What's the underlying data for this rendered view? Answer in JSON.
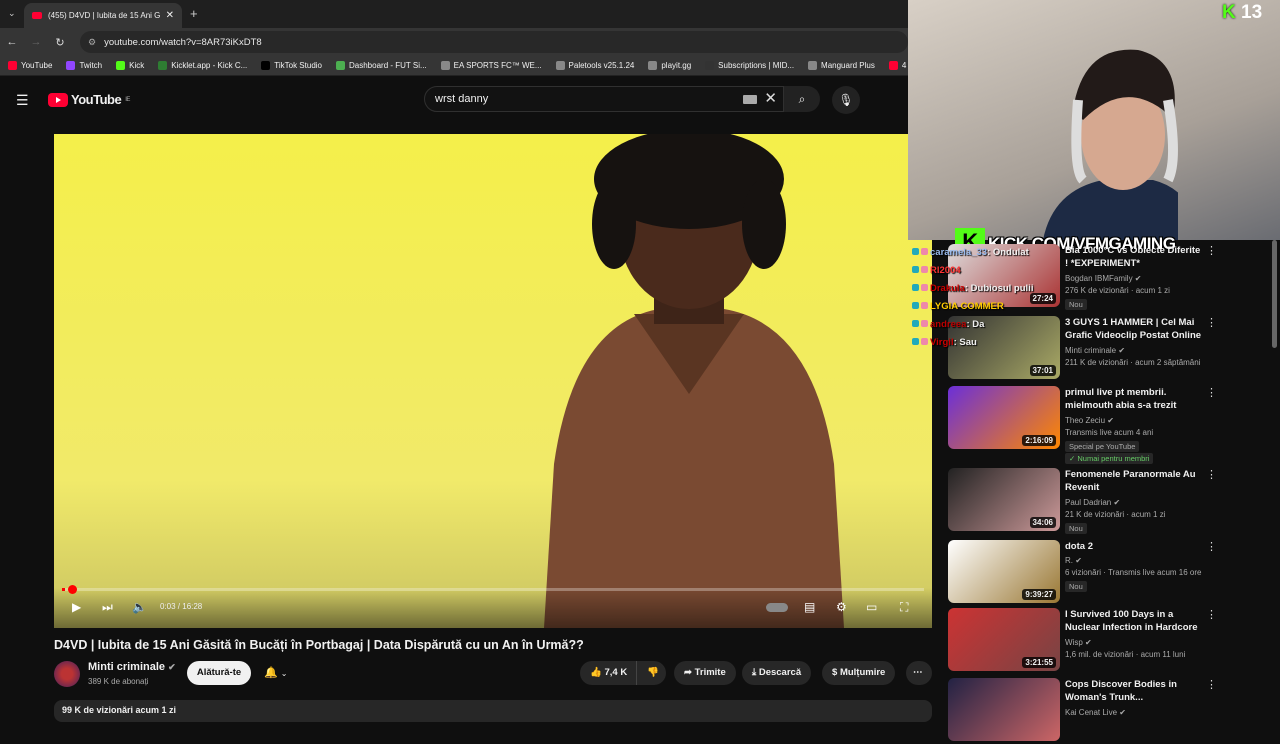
{
  "browser": {
    "tab_title": "(455) D4VD | Iubita de 15 Ani G...",
    "new_tab": "+",
    "url": "youtube.com/watch?v=8AR73iKxDT8",
    "bookmarks": [
      {
        "label": "YouTube",
        "color": "#ff0033"
      },
      {
        "label": "Twitch",
        "color": "#9146ff"
      },
      {
        "label": "Kick",
        "color": "#53fc18"
      },
      {
        "label": "Kicklet.app - Kick C...",
        "color": "#2e7d32"
      },
      {
        "label": "TikTok Studio",
        "color": "#000000"
      },
      {
        "label": "Dashboard - FUT Si...",
        "color": "#4caf50"
      },
      {
        "label": "EA SPORTS FC™ WE...",
        "color": "#888888"
      },
      {
        "label": "Paletools v25.1.24",
        "color": "#888888"
      },
      {
        "label": "playit.gg",
        "color": "#888888"
      },
      {
        "label": "Subscriptions | MID...",
        "color": "#333333"
      },
      {
        "label": "Manguard Plus",
        "color": "#888888"
      },
      {
        "label": "4 EASY Sto...",
        "color": "#ff0033"
      }
    ]
  },
  "youtube": {
    "logo_text": "YouTube",
    "logo_region": "IE",
    "search_value": "wrst danny"
  },
  "player": {
    "time": "0:03 / 16:28",
    "progress": 0.003
  },
  "video": {
    "title": "D4VD | Iubita de 15 Ani Găsită în Bucăți în Portbagaj | Data Dispărută cu un An în Urmă??",
    "channel": "Minti criminale",
    "subscribers": "389 K de abonați",
    "join_label": "Alătură-te",
    "likes": "7,4 K",
    "share_label": "Trimite",
    "download_label": "Descarcă",
    "thanks_label": "Mulțumire",
    "views_date": "99 K de vizionări  acum 1 zi"
  },
  "stream": {
    "viewer_count": "13",
    "kick_url": "KICK.COM/VFMGAMING",
    "kick_letter": "K",
    "chat": [
      {
        "user": "caramela_33",
        "message": "Ondulat"
      },
      {
        "user": "Rl2004",
        "message": ""
      },
      {
        "user": "Drakula",
        "message": "Dubiosul pulii"
      },
      {
        "user": "LYGIA COMMER",
        "message": ""
      },
      {
        "user": "andreea",
        "message": "Da"
      },
      {
        "user": "Virgil",
        "message": "Sau"
      }
    ]
  },
  "recommendations": [
    {
      "title": "Bia 1000°C vs Obiecte Diferite ! *EXPERIMENT*",
      "channel": "Bogdan IBMFamily",
      "meta": "276 K de vizionări · acum 1 zi",
      "duration": "27:24",
      "badge": "Nou",
      "extra": ""
    },
    {
      "title": "3 GUYS 1 HAMMER | Cel Mai Grafic Videoclip Postat Online ...",
      "channel": "Minti criminale",
      "meta": "211 K de vizionări · acum 2 săptămâni",
      "duration": "37:01",
      "badge": "",
      "extra": ""
    },
    {
      "title": "primul live pt membrii. mielmouth abia s-a trezit",
      "channel": "Theo Zeciu",
      "meta": "Transmis live acum 4 ani",
      "duration": "2:16:09",
      "badge": "Special pe YouTube",
      "extra": "Numai pentru membri"
    },
    {
      "title": "Fenomenele Paranormale Au Revenit",
      "channel": "Paul Dadrian",
      "meta": "21 K de vizionări · acum 1 zi",
      "duration": "34:06",
      "badge": "Nou",
      "extra": ""
    },
    {
      "title": "dota 2",
      "channel": "R.",
      "meta": "6 vizionări · Transmis live acum 16 ore",
      "duration": "9:39:27",
      "badge": "Nou",
      "extra": ""
    },
    {
      "title": "I Survived 100 Days in a Nuclear Infection in Hardcore ...",
      "channel": "Wisp",
      "meta": "1,6 mil. de vizionări · acum 11 luni",
      "duration": "3:21:55",
      "badge": "",
      "extra": ""
    },
    {
      "title": "Cops Discover Bodies in Woman's Trunk...",
      "channel": "Kai Cenat Live",
      "meta": "",
      "duration": "",
      "badge": "",
      "extra": ""
    }
  ]
}
